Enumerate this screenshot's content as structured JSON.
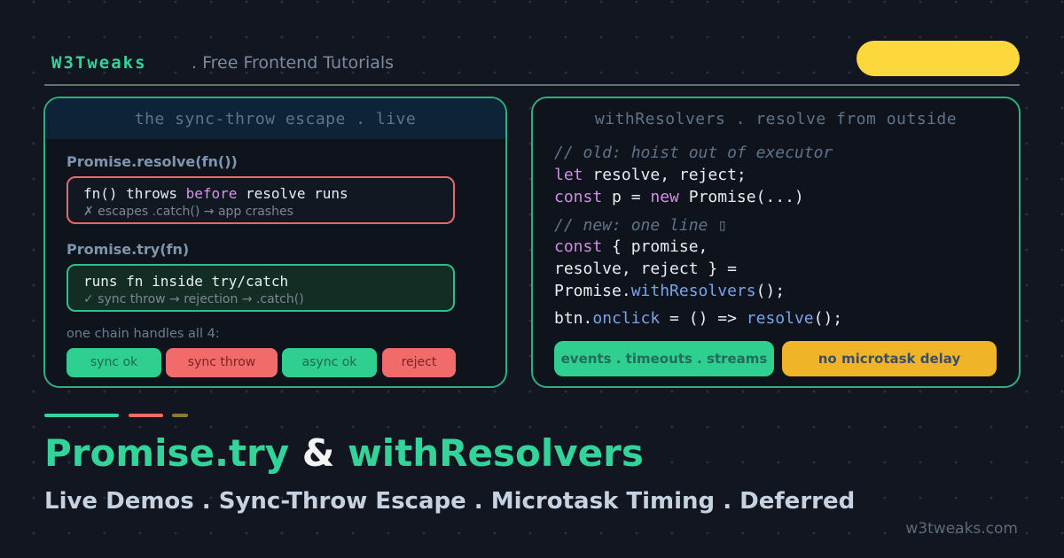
{
  "header": {
    "brand": "W3Tweaks",
    "tagline": ". Free Frontend Tutorials"
  },
  "left_panel": {
    "title": "the sync-throw escape . live",
    "section1_label": "Promise.resolve(fn())",
    "box1": {
      "line_pre": "fn() throws ",
      "line_kw": "before",
      "line_post": " resolve runs",
      "sub": "✗ escapes .catch() → app crashes"
    },
    "section2_label": "Promise.try(fn)",
    "box2": {
      "line": "runs fn inside try/catch",
      "sub": "✓ sync throw → rejection → .catch()"
    },
    "chain_label": "one chain handles all 4:",
    "chips": [
      "sync ok",
      "sync throw",
      "async ok",
      "reject"
    ]
  },
  "right_panel": {
    "title": "withResolvers . resolve from outside",
    "code": {
      "comment_old": "// old: hoist out of executor",
      "l1_kw": "let",
      "l1_rest": " resolve, reject;",
      "l2_kw1": "const",
      "l2_mid": " p = ",
      "l2_kw2": "new",
      "l2_rest": " Promise(...)",
      "comment_new": "// new: one line ▯",
      "l3_kw": "const",
      "l3_rest": " { promise,",
      "l4": "resolve, reject } =",
      "l5_obj": "Promise.",
      "l5_fn": "withResolvers",
      "l5_rest": "();",
      "l6_obj": "btn.",
      "l6_fn1": "onclick",
      "l6_mid": " = () => ",
      "l6_fn2": "resolve",
      "l6_rest": "();"
    },
    "buttons": [
      "events . timeouts . streams",
      "no microtask delay"
    ]
  },
  "hero": {
    "title_a": "Promise.try",
    "title_amp": " & ",
    "title_b": "withResolvers",
    "subtitle": "Live Demos . Sync-Throw Escape . Microtask Timing . Deferred"
  },
  "footer": {
    "site": "w3tweaks.com"
  },
  "colors": {
    "background": "#121620",
    "accent_green": "#34d399",
    "accent_red": "#f26b6b",
    "accent_yellow": "#fdd83c",
    "accent_olive": "#8a7a2e"
  }
}
